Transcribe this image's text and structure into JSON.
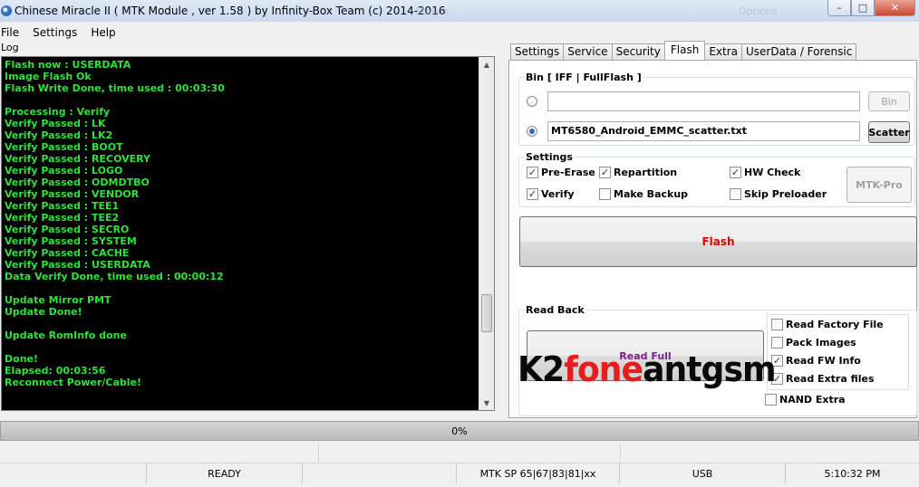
{
  "window": {
    "title": "Chinese Miracle II ( MTK Module , ver 1.58 ) by Infinity-Box Team (c) 2014-2016",
    "ghost_title_1": "Stages",
    "ghost_title_2": "Options",
    "minimize": "–",
    "maximize": "□",
    "close": "✕"
  },
  "menu": [
    "File",
    "Settings",
    "Help"
  ],
  "log": {
    "label": "Log",
    "lines": [
      "Flash now : USERDATA",
      "Image Flash Ok",
      "Flash Write Done, time used : 00:03:30",
      "",
      "Processing : Verify",
      "Verify Passed : LK",
      "Verify Passed : LK2",
      "Verify Passed : BOOT",
      "Verify Passed : RECOVERY",
      "Verify Passed : LOGO",
      "Verify Passed : ODMDTBO",
      "Verify Passed : VENDOR",
      "Verify Passed : TEE1",
      "Verify Passed : TEE2",
      "Verify Passed : SECRO",
      "Verify Passed : SYSTEM",
      "Verify Passed : CACHE",
      "Verify Passed : USERDATA",
      "Data Verify Done, time used : 00:00:12",
      "",
      "Update Mirror PMT",
      "Update Done!",
      "",
      "Update RomInfo done",
      "",
      "Done!",
      "Elapsed: 00:03:56",
      "Reconnect Power/Cable!"
    ]
  },
  "tabs": [
    {
      "label": "Settings",
      "active": false
    },
    {
      "label": "Service",
      "active": false
    },
    {
      "label": "Security",
      "active": false
    },
    {
      "label": "Flash",
      "active": true
    },
    {
      "label": "Extra",
      "active": false
    },
    {
      "label": "UserData / Forensic",
      "active": false
    }
  ],
  "bin_group": {
    "title": "Bin  [ IFF | FullFlash ]",
    "bin_path": "",
    "bin_button": "Bin",
    "scatter_path": "MT6580_Android_EMMC_scatter.txt",
    "scatter_button": "Scatter",
    "selected": "scatter"
  },
  "settings_group": {
    "title": "Settings",
    "options": [
      {
        "label": "Pre-Erase",
        "checked": true
      },
      {
        "label": "Repartition",
        "checked": true
      },
      {
        "label": "HW Check",
        "checked": true
      },
      {
        "label": "Verify",
        "checked": true
      },
      {
        "label": "Make Backup",
        "checked": false
      },
      {
        "label": "Skip Preloader",
        "checked": false
      }
    ],
    "mtk_pro_button": "MTK-Pro"
  },
  "flash_button": "Flash",
  "readback_group": {
    "title": "Read Back",
    "read_full_button": "Read Full",
    "options": [
      {
        "label": "Read Factory File",
        "checked": false
      },
      {
        "label": "Pack Images",
        "checked": false
      },
      {
        "label": "Read FW Info",
        "checked": true
      },
      {
        "label": "Read Extra files",
        "checked": true
      }
    ],
    "nand_extra": {
      "label": "NAND Extra",
      "checked": false
    }
  },
  "watermark": {
    "part1": "K2",
    "part2": "fone",
    "part3": "antgsm"
  },
  "progress": {
    "text": "0%",
    "value": 0
  },
  "status": {
    "state": "READY",
    "chip": "MTK SP 65|67|83|81|xx",
    "connection": "USB",
    "time": "5:10:32 PM"
  },
  "colors": {
    "log_text": "#2fe23a",
    "log_bg": "#000000",
    "flash_text": "#e00000",
    "watermark_red": "#e51d1d"
  }
}
